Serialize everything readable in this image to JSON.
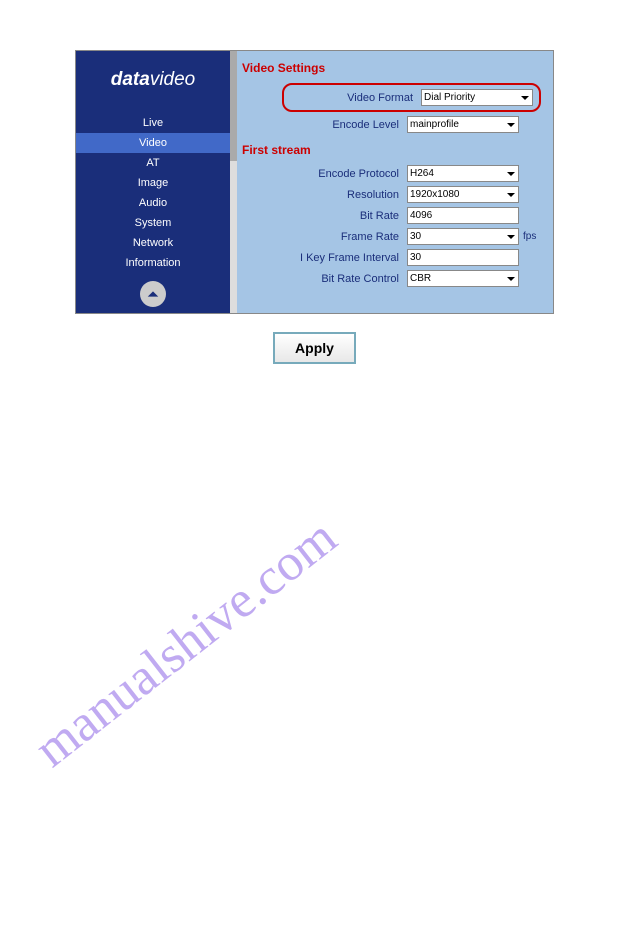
{
  "logo": {
    "part1": "data",
    "part2": "video"
  },
  "sidebar": {
    "items": [
      {
        "label": "Live"
      },
      {
        "label": "Video"
      },
      {
        "label": "AT"
      },
      {
        "label": "Image"
      },
      {
        "label": "Audio"
      },
      {
        "label": "System"
      },
      {
        "label": "Network"
      },
      {
        "label": "Information"
      }
    ]
  },
  "sections": {
    "video_settings": {
      "title": "Video Settings",
      "video_format": {
        "label": "Video Format",
        "value": "Dial Priority"
      },
      "encode_level": {
        "label": "Encode Level",
        "value": "mainprofile"
      }
    },
    "first_stream": {
      "title": "First stream",
      "encode_protocol": {
        "label": "Encode Protocol",
        "value": "H264"
      },
      "resolution": {
        "label": "Resolution",
        "value": "1920x1080"
      },
      "bit_rate": {
        "label": "Bit Rate",
        "value": "4096"
      },
      "frame_rate": {
        "label": "Frame Rate",
        "value": "30",
        "suffix": "fps"
      },
      "i_key_frame_interval": {
        "label": "I Key Frame Interval",
        "value": "30"
      },
      "bit_rate_control": {
        "label": "Bit Rate Control",
        "value": "CBR"
      }
    }
  },
  "apply": {
    "label": "Apply"
  },
  "watermark": "manualshive.com"
}
